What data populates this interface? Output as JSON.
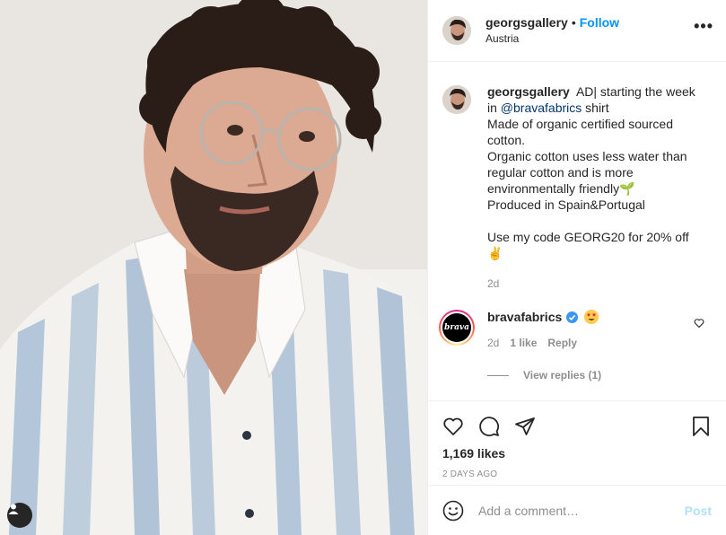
{
  "header": {
    "username": "georgsgallery",
    "separator": "•",
    "follow_label": "Follow",
    "location": "Austria",
    "more_label": "•••"
  },
  "caption": {
    "username": "georgsgallery",
    "text_start": "AD| starting the week in",
    "mention": "@bravafabrics",
    "text_after_mention": "shirt",
    "lines": [
      "Made of organic certified sourced cotton.",
      "Organic cotton uses less water than regular cotton and is more environmentally friendly🌱",
      "Produced in Spain&Portugal"
    ],
    "code_line": "Use my code GEORG20 for 20% off",
    "code_emoji": "✌️",
    "time": "2d"
  },
  "comment": {
    "username": "bravafabrics",
    "avatar_text": "brava",
    "emoji_icon": "heart-eyes-emoji",
    "time": "2d",
    "likes": "1 like",
    "reply_label": "Reply",
    "view_replies": "View replies (1)"
  },
  "post_footer": {
    "likes": "1,169 likes",
    "date": "2 DAYS AGO"
  },
  "add_comment": {
    "placeholder": "Add a comment…",
    "post_label": "Post"
  },
  "colors": {
    "accent": "#0095f6",
    "mention": "#00376b",
    "muted": "#8e8e8e",
    "post_disabled": "#b2dffc",
    "verified": "#3897f0"
  }
}
